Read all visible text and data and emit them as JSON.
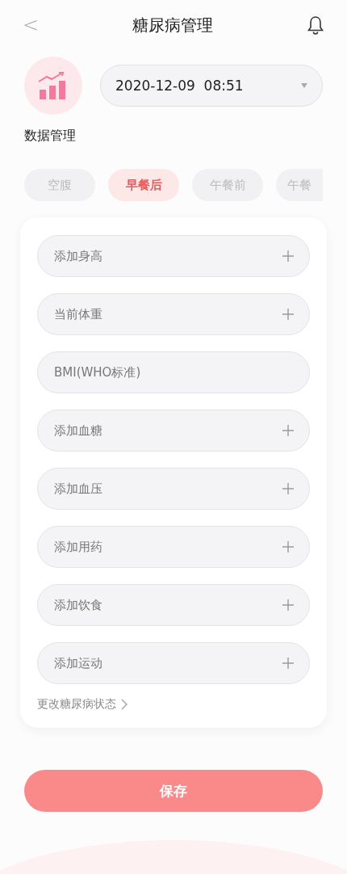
{
  "header": {
    "back": "<",
    "title": "糖尿病管理"
  },
  "profile": {
    "label": "数据管理"
  },
  "date_picker": {
    "value": "2020-12-09  08:51"
  },
  "tabs": [
    {
      "label": "空腹",
      "selected": false
    },
    {
      "label": "早餐后",
      "selected": true
    },
    {
      "label": "午餐前",
      "selected": false
    },
    {
      "label": "午餐",
      "selected": false
    }
  ],
  "fields": [
    {
      "label": "添加身高",
      "kind": "add"
    },
    {
      "label": "当前体重",
      "kind": "add"
    },
    {
      "label": "BMI(WHO标准)",
      "kind": "readonly"
    },
    {
      "label": "添加血糖",
      "kind": "add"
    },
    {
      "label": "添加血压",
      "kind": "add"
    },
    {
      "label": "添加用药",
      "kind": "add"
    },
    {
      "label": "添加饮食",
      "kind": "add"
    },
    {
      "label": "添加运动",
      "kind": "add"
    }
  ],
  "status_link": {
    "label": "更改糖尿病状态"
  },
  "save_button": {
    "label": "保存"
  }
}
